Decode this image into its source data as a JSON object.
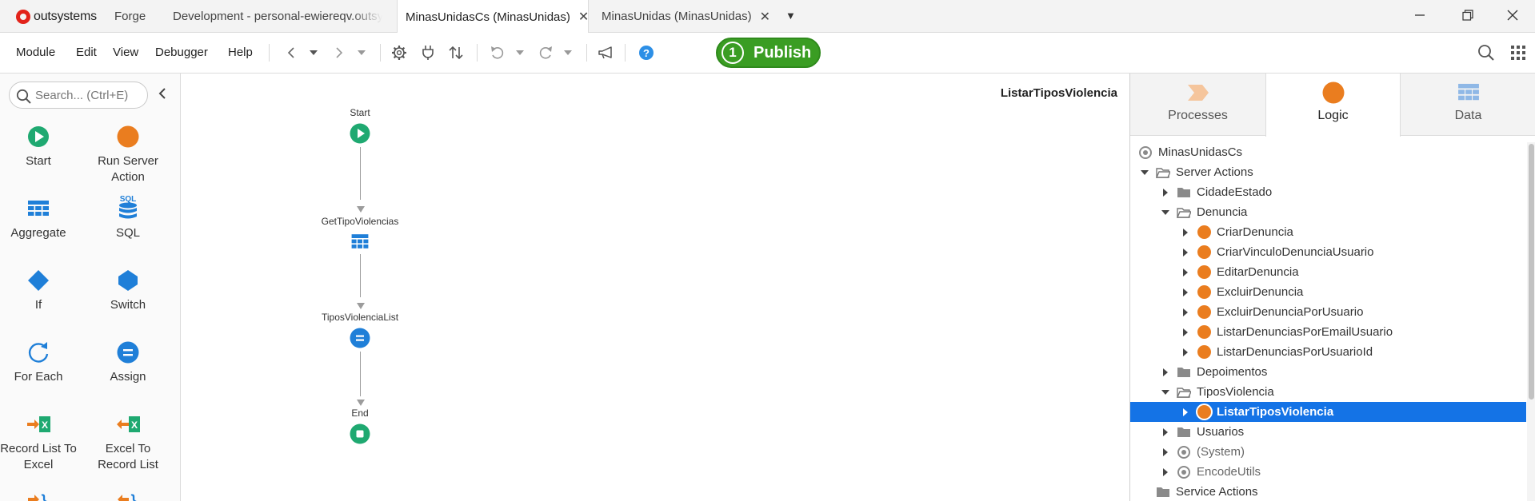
{
  "app": {
    "brand": "outsystems",
    "tabs": [
      {
        "label": "Forge"
      },
      {
        "label": "Development - personal-ewiereqv.outsystemscloud.com"
      },
      {
        "label": "MinasUnidasCs (MinasUnidas)",
        "close": "✕"
      },
      {
        "label": "MinasUnidas (MinasUnidas)",
        "close": "✕"
      }
    ]
  },
  "menu": [
    "Module",
    "Edit",
    "View",
    "Debugger",
    "Help"
  ],
  "publish": {
    "step": "1",
    "label": "Publish"
  },
  "toolbox": {
    "search_placeholder": "Search... (Ctrl+E)",
    "items": [
      {
        "label": "Start",
        "icon": "start-icon"
      },
      {
        "label": "Run Server Action",
        "icon": "run-server-action-icon"
      },
      {
        "label": "Aggregate",
        "icon": "aggregate-icon"
      },
      {
        "label": "SQL",
        "icon": "sql-icon",
        "icon_text": "SQL"
      },
      {
        "label": "If",
        "icon": "if-icon"
      },
      {
        "label": "Switch",
        "icon": "switch-icon"
      },
      {
        "label": "For Each",
        "icon": "for-each-icon"
      },
      {
        "label": "Assign",
        "icon": "assign-icon"
      },
      {
        "label": "Record List To Excel",
        "icon": "record-list-to-excel-icon"
      },
      {
        "label": "Excel To Record List",
        "icon": "excel-to-record-list-icon"
      }
    ]
  },
  "canvas": {
    "title": "ListarTiposViolencia",
    "nodes": [
      {
        "label": "Start",
        "icon": "start-icon"
      },
      {
        "label": "GetTipoViolencias",
        "icon": "aggregate-icon"
      },
      {
        "label": "TiposViolenciaList",
        "icon": "assign-icon"
      },
      {
        "label": "End",
        "icon": "end-icon"
      }
    ]
  },
  "panel": {
    "tabs": [
      {
        "label": "Processes",
        "icon": "processes-icon"
      },
      {
        "label": "Logic",
        "icon": "logic-icon",
        "active": true
      },
      {
        "label": "Data",
        "icon": "data-icon"
      }
    ],
    "tree": [
      {
        "label": "MinasUnidasCs",
        "type": "module"
      },
      {
        "label": "Server Actions",
        "type": "folder-open"
      },
      {
        "label": "CidadeEstado",
        "type": "folder"
      },
      {
        "label": "Denuncia",
        "type": "folder-open"
      },
      {
        "label": "CriarDenuncia",
        "type": "action"
      },
      {
        "label": "CriarVinculoDenunciaUsuario",
        "type": "action"
      },
      {
        "label": "EditarDenuncia",
        "type": "action"
      },
      {
        "label": "ExcluirDenuncia",
        "type": "action"
      },
      {
        "label": "ExcluirDenunciaPorUsuario",
        "type": "action"
      },
      {
        "label": "ListarDenunciasPorEmailUsuario",
        "type": "action"
      },
      {
        "label": "ListarDenunciasPorUsuarioId",
        "type": "action"
      },
      {
        "label": "Depoimentos",
        "type": "folder"
      },
      {
        "label": "TiposViolencia",
        "type": "folder-open"
      },
      {
        "label": "ListarTiposViolencia",
        "type": "action",
        "selected": true
      },
      {
        "label": "Usuarios",
        "type": "folder"
      },
      {
        "label": "(System)",
        "type": "module"
      },
      {
        "label": "EncodeUtils",
        "type": "module"
      },
      {
        "label": "Service Actions",
        "type": "folder"
      }
    ]
  },
  "colors": {
    "publish_green": "#3a9d23",
    "action_orange": "#ea7d1f",
    "selection_blue": "#1473e6",
    "flow_green": "#1fa971",
    "flow_blue": "#1f7fd8"
  }
}
